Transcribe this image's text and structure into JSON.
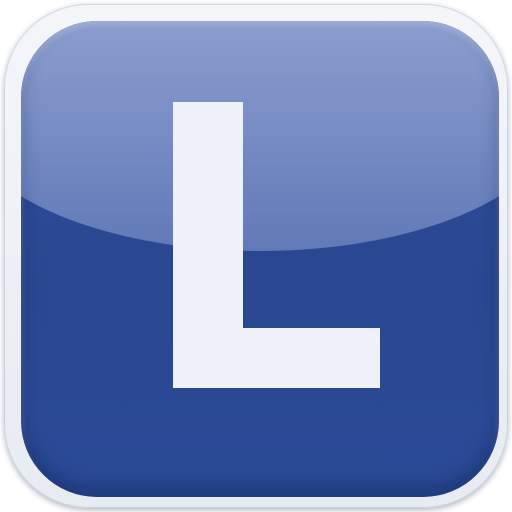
{
  "app_icon": {
    "letter": "L",
    "colors": {
      "tile_top": "#b4c1e2",
      "tile_mid": "#6179b8",
      "tile_bottom": "#2b4a97",
      "letter": "#eef1f7",
      "frame": "#f4f6fa"
    }
  }
}
